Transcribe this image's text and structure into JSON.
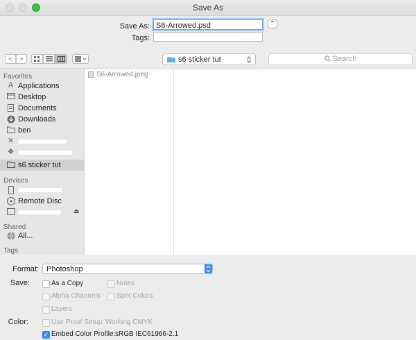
{
  "window": {
    "title": "Save As"
  },
  "save": {
    "save_as_label": "Save As:",
    "filename": "S6-Arrowed.psd",
    "tags_label": "Tags:",
    "tags_value": "",
    "collapse_glyph": "⌃"
  },
  "toolbar": {
    "back_glyph": "<",
    "forward_glyph": ">",
    "icon_view": "icon-view-icon",
    "list_view": "list-view-icon",
    "column_view": "column-view-icon",
    "gallery_view": "gallery-view-icon",
    "location": "s6 sticker tut",
    "search_placeholder": "Search"
  },
  "sidebar": {
    "favorites_heading": "Favorites",
    "favorites": [
      {
        "label": "Applications",
        "icon": "applications-icon"
      },
      {
        "label": "Desktop",
        "icon": "desktop-icon"
      },
      {
        "label": "Documents",
        "icon": "documents-icon"
      },
      {
        "label": "Downloads",
        "icon": "downloads-icon"
      },
      {
        "label": "ben",
        "icon": "home-folder-icon"
      },
      {
        "label": "s6 sticker tut",
        "icon": "folder-icon",
        "selected": true
      }
    ],
    "devices_heading": "Devices",
    "devices": [
      {
        "label": "Remote Disc",
        "icon": "disc-icon"
      }
    ],
    "shared_heading": "Shared",
    "shared": [
      {
        "label": "All...",
        "icon": "network-icon"
      }
    ],
    "tags_heading": "Tags"
  },
  "files": [
    {
      "name": "S6-Arrowed.jpeg",
      "icon": "image-file-icon"
    }
  ],
  "options": {
    "format_label": "Format:",
    "format_value": "Photoshop",
    "save_label": "Save:",
    "as_a_copy": "As a Copy",
    "notes": "Notes",
    "alpha_channels": "Alpha Channels",
    "spot_colors": "Spot Colors",
    "layers": "Layers",
    "color_label": "Color:",
    "use_proof_setup": "Use Proof Setup:",
    "proof_value": "Working CMYK",
    "embed_color_profile": "Embed Color Profile:",
    "profile_value": "sRGB IEC61966-2.1"
  },
  "colors": {
    "accent": "#3b8ef5",
    "selection": "#d0d0d0"
  }
}
